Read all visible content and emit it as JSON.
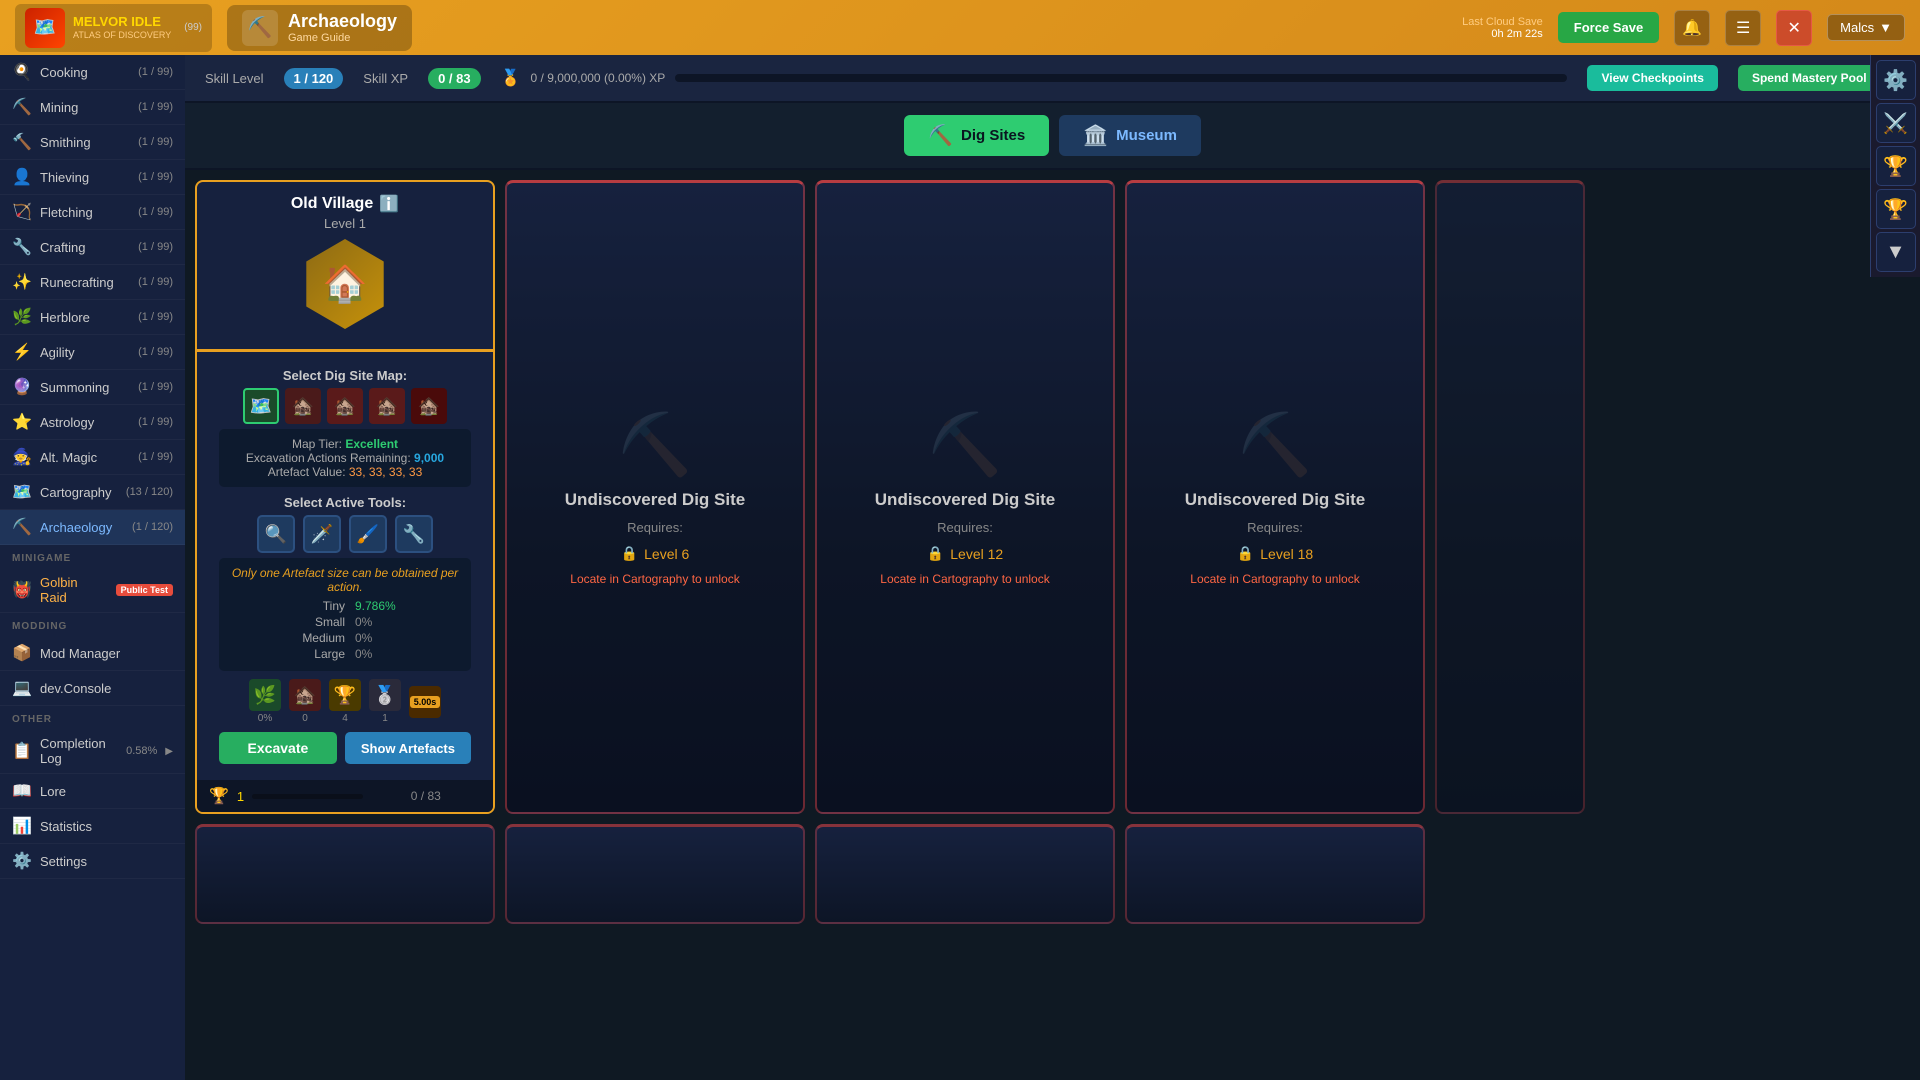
{
  "header": {
    "logo": {
      "title": "MELVOR IDLE",
      "subtitle": "ATLAS OF DISCOVERY",
      "icon": "🗺️"
    },
    "skill": {
      "name": "Archaeology",
      "subtitle": "Game Guide",
      "icon": "⛏️"
    },
    "cloud_save": {
      "label": "Last Cloud Save",
      "time": "0h 2m 22s"
    },
    "force_save": "Force Save",
    "username": "Malcs",
    "level_label": "Skill Level",
    "level_value": "1 / 120",
    "xp_label": "Skill XP",
    "xp_value": "0 / 83",
    "mastery_text": "0 / 9,000,000 (0.00%) XP",
    "view_checkpoints": "View Checkpoints",
    "spend_mastery": "Spend Mastery Pool XP"
  },
  "sidebar": {
    "skills": [
      {
        "icon": "🍳",
        "label": "Cooking",
        "count": "(1 / 99)"
      },
      {
        "icon": "⛏️",
        "label": "Mining",
        "count": "(1 / 99)"
      },
      {
        "icon": "🔨",
        "label": "Smithing",
        "count": "(1 / 99)"
      },
      {
        "icon": "👤",
        "label": "Thieving",
        "count": "(1 / 99)"
      },
      {
        "icon": "🏹",
        "label": "Fletching",
        "count": "(1 / 99)"
      },
      {
        "icon": "🔧",
        "label": "Crafting",
        "count": "(1 / 99)"
      },
      {
        "icon": "✨",
        "label": "Runecrafting",
        "count": "(1 / 99)"
      },
      {
        "icon": "🌿",
        "label": "Herblore",
        "count": "(1 / 99)"
      },
      {
        "icon": "⚡",
        "label": "Agility",
        "count": "(1 / 99)"
      },
      {
        "icon": "🔮",
        "label": "Summoning",
        "count": "(1 / 99)"
      },
      {
        "icon": "⭐",
        "label": "Astrology",
        "count": "(1 / 99)"
      },
      {
        "icon": "🧙",
        "label": "Alt. Magic",
        "count": "(1 / 99)"
      },
      {
        "icon": "🗺️",
        "label": "Cartography",
        "count": "(13 / 120)"
      },
      {
        "icon": "⛏️",
        "label": "Archaeology",
        "count": "(1 / 120)",
        "active": true
      }
    ],
    "minigame_section": "MINIGAME",
    "minigames": [
      {
        "icon": "👹",
        "label": "Golbin Raid",
        "badge": "Public Test"
      }
    ],
    "modding_section": "MODDING",
    "modding": [
      {
        "icon": "📦",
        "label": "Mod Manager"
      },
      {
        "icon": "💻",
        "label": "dev.Console"
      }
    ],
    "other_section": "OTHER",
    "other": [
      {
        "icon": "📋",
        "label": "Completion Log",
        "count": "0.58%",
        "has_arrow": true
      },
      {
        "icon": "📖",
        "label": "Lore"
      },
      {
        "icon": "📊",
        "label": "Statistics"
      },
      {
        "icon": "⚙️",
        "label": "Settings"
      }
    ]
  },
  "tabs": {
    "dig_sites": "Dig Sites",
    "museum": "Museum"
  },
  "active_tab": "dig_sites",
  "old_village": {
    "name": "Old Village",
    "info_icon": "ℹ️",
    "level": "Level 1",
    "map_tier_label": "Map Tier:",
    "map_tier_value": "Excellent",
    "excavation_label": "Excavation Actions Remaining:",
    "excavation_value": "9,000",
    "artefact_label": "Artefact Value:",
    "artefact_values": "33, 33, 33, 33",
    "artefact_warning": "Only one Artefact size can be obtained per action.",
    "tiny_label": "Tiny",
    "tiny_pct": "9.786%",
    "small_label": "Small",
    "small_pct": "0%",
    "medium_label": "Medium",
    "medium_pct": "0%",
    "large_label": "Large",
    "large_pct": "0%",
    "pct1": "0%",
    "pct2": "0",
    "trophy_count": "4",
    "trophy1": "1",
    "time_val": "5.00s",
    "progress_current": "0",
    "progress_max": "83",
    "trophy_num": "1",
    "excavate_btn": "Excavate",
    "show_artefacts_btn": "Show Artefacts"
  },
  "undiscovered": [
    {
      "title": "Undiscovered Dig Site",
      "requires": "Requires:",
      "level": "Level 6",
      "note": "Locate in Cartography to unlock"
    },
    {
      "title": "Undiscovered Dig Site",
      "requires": "Requires:",
      "level": "Level 12",
      "note": "Locate in Cartography to unlock"
    },
    {
      "title": "Undiscovered Dig Site",
      "requires": "Requires:",
      "level": "Level 18",
      "note": "Locate in Cartography to unlock"
    }
  ],
  "right_panel": {
    "gear": "⚙️",
    "sword": "⚔️",
    "trophy": "🏆",
    "trophy2": "🏆",
    "chevron": "▼"
  }
}
